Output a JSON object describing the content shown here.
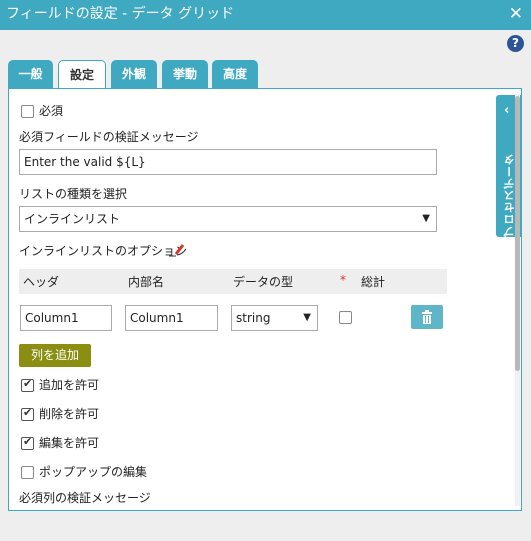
{
  "window": {
    "title": "フィールドの設定 - データ グリッド",
    "close_glyph": "✕",
    "help_glyph": "?"
  },
  "tabs": [
    {
      "label": "一般"
    },
    {
      "label": "設定"
    },
    {
      "label": "外観"
    },
    {
      "label": "挙動"
    },
    {
      "label": "高度"
    }
  ],
  "side_panel": {
    "label": "プロセスデータ",
    "chevron": "‹"
  },
  "settings": {
    "required_label": "必須",
    "required_checked": false,
    "validation_message_label": "必須フィールドの検証メッセージ",
    "validation_message_value": "Enter the valid ${L}",
    "list_type_label": "リストの種類を選択",
    "list_type_value": "インラインリスト",
    "inline_options_label": "インラインリストのオプション"
  },
  "grid": {
    "headers": {
      "header": "ヘッダ",
      "internal_name": "内部名",
      "data_type": "データの型",
      "required_mark": "*",
      "total": "総計"
    },
    "rows": [
      {
        "header": "Column1",
        "internal_name": "Column1",
        "data_type": "string",
        "total_checked": false
      }
    ],
    "add_column_label": "列を追加"
  },
  "options": [
    {
      "label": "追加を許可",
      "checked": true
    },
    {
      "label": "削除を許可",
      "checked": true
    },
    {
      "label": "編集を許可",
      "checked": true
    },
    {
      "label": "ポップアップの編集",
      "checked": false
    }
  ],
  "required_column_message_label": "必須列の検証メッセージ",
  "colors": {
    "accent": "#3fa9c2",
    "olive_button": "#8a8f12",
    "trash_button": "#5fb6c9",
    "required_star": "#e03030",
    "pencil": "#d0362e",
    "help": "#2b5597"
  }
}
